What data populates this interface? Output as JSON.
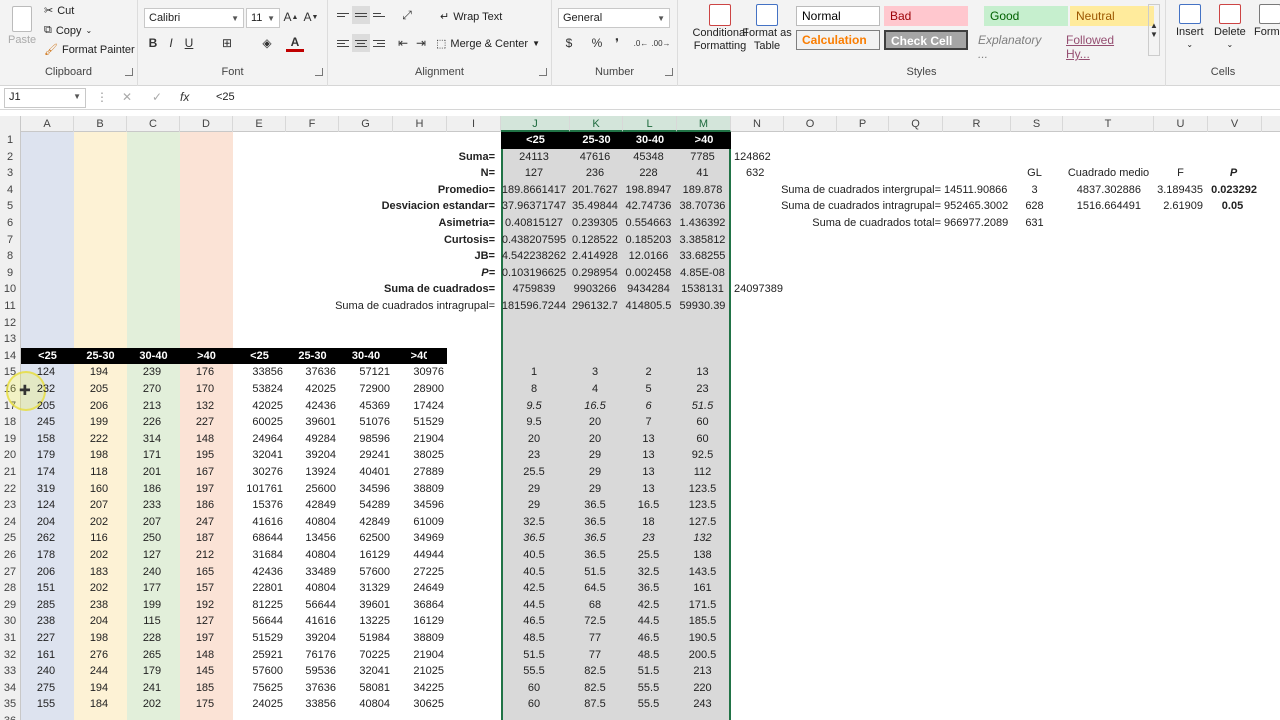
{
  "ribbon": {
    "clipboard": {
      "paste": "Paste",
      "cut": "Cut",
      "copy": "Copy",
      "format_painter": "Format Painter",
      "label": "Clipboard"
    },
    "font": {
      "name": "Calibri",
      "size": "11",
      "label": "Font"
    },
    "alignment": {
      "wrap": "Wrap Text",
      "merge": "Merge & Center",
      "label": "Alignment"
    },
    "number": {
      "format": "General",
      "label": "Number"
    },
    "styles": {
      "cond": "Conditional Formatting",
      "table": "Format as Table",
      "normal": "Normal",
      "bad": "Bad",
      "good": "Good",
      "neutral": "Neutral",
      "calc": "Calculation",
      "check": "Check Cell",
      "expl": "Explanatory ...",
      "followed": "Followed Hy...",
      "label": "Styles"
    },
    "cells": {
      "insert": "Insert",
      "delete": "Delete",
      "format": "Forma",
      "label": "Cells"
    }
  },
  "formula_bar": {
    "name_box": "J1",
    "fx": "fx",
    "value": "<25"
  },
  "columns": [
    "A",
    "B",
    "C",
    "D",
    "E",
    "F",
    "G",
    "H",
    "I",
    "J",
    "K",
    "L",
    "M",
    "N",
    "O",
    "P",
    "Q",
    "R",
    "S",
    "T",
    "U",
    "V"
  ],
  "rows": [
    "1",
    "2",
    "3",
    "4",
    "5",
    "6",
    "7",
    "8",
    "9",
    "10",
    "11",
    "12",
    "13",
    "14",
    "15",
    "16",
    "17",
    "18",
    "19",
    "20",
    "21",
    "22",
    "23",
    "24",
    "25",
    "26",
    "27",
    "28",
    "29",
    "30",
    "31",
    "32",
    "33",
    "34",
    "35",
    "36"
  ],
  "group_headers": [
    "<25",
    "25-30",
    "30-40",
    ">40"
  ],
  "stats_labels": [
    "Suma=",
    "N=",
    "Promedio=",
    "Desviacion estandar=",
    "Asimetria=",
    "Curtosis=",
    "JB=",
    "P=",
    "Suma de cuadrados=",
    "Suma de cuadrados intragrupal="
  ],
  "stats": [
    [
      "24113",
      "47616",
      "45348",
      "7785"
    ],
    [
      "127",
      "236",
      "228",
      "41"
    ],
    [
      "189.8661417",
      "201.7627",
      "198.8947",
      "189.878"
    ],
    [
      "37.96371747",
      "35.49844",
      "42.74736",
      "38.70736"
    ],
    [
      "0.40815127",
      "0.239305",
      "0.554663",
      "1.436392"
    ],
    [
      "0.438207595",
      "0.128522",
      "0.185203",
      "3.385812"
    ],
    [
      "4.542238262",
      "2.414928",
      "12.0166",
      "33.68255"
    ],
    [
      "0.103196625",
      "0.298954",
      "0.002458",
      "4.85E-08"
    ],
    [
      "4759839",
      "9903266",
      "9434284",
      "1538131"
    ],
    [
      "181596.7244",
      "296132.7",
      "414805.5",
      "59930.39"
    ]
  ],
  "totals": {
    "suma": "124862",
    "n": "632",
    "ss": "24097389"
  },
  "anova": {
    "gl_h": "GL",
    "cm_h": "Cuadrado medio",
    "f_h": "F",
    "p_h": "P",
    "inter_label": "Suma de cuadrados intergrupal=",
    "inter": "14511.90866",
    "inter_gl": "3",
    "inter_cm": "4837.302886",
    "inter_f": "3.189435",
    "inter_p": "0.023292",
    "intra_label": "Suma de cuadrados intragrupal=",
    "intra": "952465.3002",
    "intra_gl": "628",
    "intra_cm": "1516.664491",
    "intra_f": "2.61909",
    "intra_p": "0.05",
    "total_label": "Suma de cuadrados total=",
    "total": "966977.2089",
    "total_gl": "631"
  },
  "data": [
    [
      "124",
      "194",
      "239",
      "176",
      "33856",
      "37636",
      "57121",
      "30976"
    ],
    [
      "232",
      "205",
      "270",
      "170",
      "53824",
      "42025",
      "72900",
      "28900"
    ],
    [
      "205",
      "206",
      "213",
      "132",
      "42025",
      "42436",
      "45369",
      "17424"
    ],
    [
      "245",
      "199",
      "226",
      "227",
      "60025",
      "39601",
      "51076",
      "51529"
    ],
    [
      "158",
      "222",
      "314",
      "148",
      "24964",
      "49284",
      "98596",
      "21904"
    ],
    [
      "179",
      "198",
      "171",
      "195",
      "32041",
      "39204",
      "29241",
      "38025"
    ],
    [
      "174",
      "118",
      "201",
      "167",
      "30276",
      "13924",
      "40401",
      "27889"
    ],
    [
      "319",
      "160",
      "186",
      "197",
      "101761",
      "25600",
      "34596",
      "38809"
    ],
    [
      "124",
      "207",
      "233",
      "186",
      "15376",
      "42849",
      "54289",
      "34596"
    ],
    [
      "204",
      "202",
      "207",
      "247",
      "41616",
      "40804",
      "42849",
      "61009"
    ],
    [
      "262",
      "116",
      "250",
      "187",
      "68644",
      "13456",
      "62500",
      "34969"
    ],
    [
      "178",
      "202",
      "127",
      "212",
      "31684",
      "40804",
      "16129",
      "44944"
    ],
    [
      "206",
      "183",
      "240",
      "165",
      "42436",
      "33489",
      "57600",
      "27225"
    ],
    [
      "151",
      "202",
      "177",
      "157",
      "22801",
      "40804",
      "31329",
      "24649"
    ],
    [
      "285",
      "238",
      "199",
      "192",
      "81225",
      "56644",
      "39601",
      "36864"
    ],
    [
      "238",
      "204",
      "115",
      "127",
      "56644",
      "41616",
      "13225",
      "16129"
    ],
    [
      "227",
      "198",
      "228",
      "197",
      "51529",
      "39204",
      "51984",
      "38809"
    ],
    [
      "161",
      "276",
      "265",
      "148",
      "25921",
      "76176",
      "70225",
      "21904"
    ],
    [
      "240",
      "244",
      "179",
      "145",
      "57600",
      "59536",
      "32041",
      "21025"
    ],
    [
      "275",
      "194",
      "241",
      "185",
      "75625",
      "37636",
      "58081",
      "34225"
    ],
    [
      "155",
      "184",
      "202",
      "175",
      "24025",
      "33856",
      "40804",
      "30625"
    ]
  ],
  "ranks": [
    [
      "1",
      "3",
      "2",
      "13"
    ],
    [
      "8",
      "4",
      "5",
      "23"
    ],
    [
      "9.5",
      "16.5",
      "6",
      "51.5"
    ],
    [
      "9.5",
      "20",
      "7",
      "60"
    ],
    [
      "20",
      "20",
      "13",
      "60"
    ],
    [
      "23",
      "29",
      "13",
      "92.5"
    ],
    [
      "25.5",
      "29",
      "13",
      "112"
    ],
    [
      "29",
      "29",
      "13",
      "123.5"
    ],
    [
      "29",
      "36.5",
      "16.5",
      "123.5"
    ],
    [
      "32.5",
      "36.5",
      "18",
      "127.5"
    ],
    [
      "36.5",
      "36.5",
      "23",
      "132"
    ],
    [
      "40.5",
      "36.5",
      "25.5",
      "138"
    ],
    [
      "40.5",
      "51.5",
      "32.5",
      "143.5"
    ],
    [
      "42.5",
      "64.5",
      "36.5",
      "161"
    ],
    [
      "44.5",
      "68",
      "42.5",
      "171.5"
    ],
    [
      "46.5",
      "72.5",
      "44.5",
      "185.5"
    ],
    [
      "48.5",
      "77",
      "46.5",
      "190.5"
    ],
    [
      "51.5",
      "77",
      "48.5",
      "200.5"
    ],
    [
      "55.5",
      "82.5",
      "51.5",
      "213"
    ],
    [
      "60",
      "82.5",
      "55.5",
      "220"
    ],
    [
      "60",
      "87.5",
      "55.5",
      "243"
    ]
  ],
  "colors": {
    "excel_green": "#217346",
    "band_a": "#dde3ef",
    "band_b": "#fdf2d5",
    "band_c": "#e2efda",
    "band_d": "#fbe3d6"
  }
}
